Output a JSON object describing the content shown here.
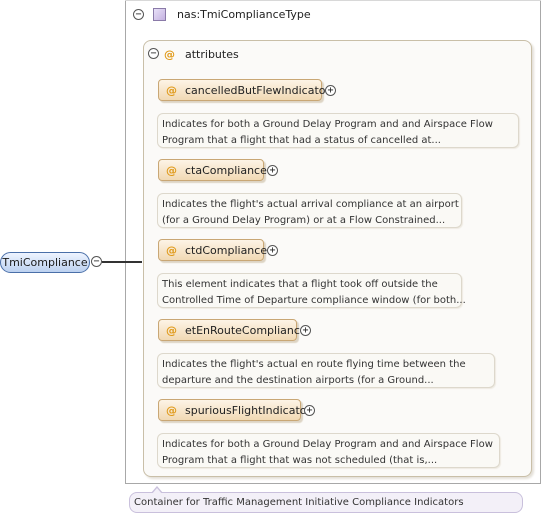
{
  "type_node": {
    "name": "nas:TmiComplianceType"
  },
  "attributes_group": {
    "title": "attributes"
  },
  "root_element": {
    "name": "TmiCompliance"
  },
  "attributes": [
    {
      "name": "cancelledButFlewIndicator",
      "doc": [
        "Indicates for both a Ground Delay Program and and Airspace Flow",
        "Program that a flight that had a status of cancelled at..."
      ]
    },
    {
      "name": "ctaCompliance",
      "doc": [
        "Indicates the flight's actual arrival compliance at an airport",
        "(for a Ground Delay Program) or at a Flow Constrained..."
      ]
    },
    {
      "name": "ctdCompliance",
      "doc": [
        "This element indicates that a flight took off outside the",
        "Controlled Time of Departure compliance window (for both..."
      ]
    },
    {
      "name": "etEnRouteCompliance",
      "doc": [
        "Indicates the flight's actual en route flying time between the",
        "departure and the destination airports (for a Ground..."
      ]
    },
    {
      "name": "spuriousFlightIndicator",
      "doc": [
        "Indicates for both a Ground Delay Program and and Airspace Flow",
        "Program that a flight that was not scheduled (that is,..."
      ]
    }
  ],
  "footer_doc": "Container for Traffic Management Initiative Compliance Indicators",
  "symbols": {
    "at": "@",
    "collapse": "−",
    "expand": "+"
  }
}
